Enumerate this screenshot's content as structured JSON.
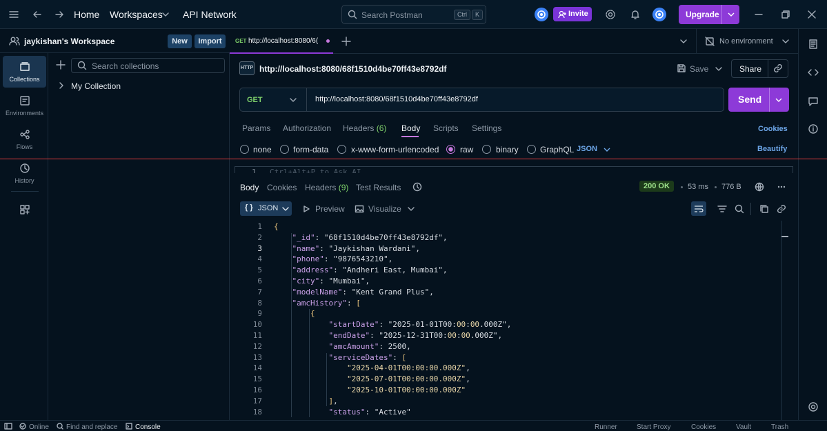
{
  "topbar": {
    "home": "Home",
    "workspaces": "Workspaces",
    "api_network": "API Network",
    "search_placeholder": "Search Postman",
    "kbd_ctrl": "Ctrl",
    "kbd_k": "K",
    "invite": "Invite",
    "upgrade": "Upgrade"
  },
  "workspace": {
    "name": "jaykishan's Workspace",
    "new_label": "New",
    "import_label": "Import"
  },
  "rail": {
    "items": [
      {
        "label": "Collections",
        "icon": "collections-icon"
      },
      {
        "label": "Environments",
        "icon": "environments-icon"
      },
      {
        "label": "Flows",
        "icon": "flows-icon"
      },
      {
        "label": "History",
        "icon": "history-icon"
      }
    ]
  },
  "sidebar": {
    "search_placeholder": "Search collections",
    "collection": "My Collection"
  },
  "tab": {
    "method": "GET",
    "title": "http://localhost:8080/6("
  },
  "environment": "No environment",
  "request": {
    "title": "http://localhost:8080/68f1510d4be70ff43e8792df",
    "save": "Save",
    "share": "Share",
    "method": "GET",
    "url": "http://localhost:8080/68f1510d4be70ff43e8792df",
    "send": "Send"
  },
  "request_tabs": {
    "params": "Params",
    "authorization": "Authorization",
    "headers": "Headers",
    "headers_count": "(6)",
    "body": "Body",
    "scripts": "Scripts",
    "settings": "Settings",
    "cookies": "Cookies"
  },
  "body_modes": {
    "none": "none",
    "form_data": "form-data",
    "urlencoded": "x-www-form-urlencoded",
    "raw": "raw",
    "binary": "binary",
    "graphql": "GraphQL",
    "json": "JSON",
    "beautify": "Beautify"
  },
  "editor_hint": "Ctrl+Alt+P to Ask AI",
  "editor_line": "1",
  "response": {
    "tabs": {
      "body": "Body",
      "cookies": "Cookies",
      "headers": "Headers",
      "headers_count": "(9)",
      "test_results": "Test Results"
    },
    "status": "200 OK",
    "time": "53 ms",
    "size": "776 B",
    "format": "JSON",
    "preview": "Preview",
    "visualize": "Visualize"
  },
  "code_lines": [
    {
      "n": "1",
      "t": "{"
    },
    {
      "n": "2",
      "t": "    \"_id\": \"68f1510d4be70ff43e8792df\","
    },
    {
      "n": "3",
      "t": "    \"name\": \"Jaykishan Wardani\","
    },
    {
      "n": "4",
      "t": "    \"phone\": \"9876543210\","
    },
    {
      "n": "5",
      "t": "    \"address\": \"Andheri East, Mumbai\","
    },
    {
      "n": "6",
      "t": "    \"city\": \"Mumbai\","
    },
    {
      "n": "7",
      "t": "    \"modelName\": \"Kent Grand Plus\","
    },
    {
      "n": "8",
      "t": "    \"amcHistory\": ["
    },
    {
      "n": "9",
      "t": "        {"
    },
    {
      "n": "10",
      "t": "            \"startDate\": \"2025-01-01T00:00:00.000Z\","
    },
    {
      "n": "11",
      "t": "            \"endDate\": \"2025-12-31T00:00:00.000Z\","
    },
    {
      "n": "12",
      "t": "            \"amcAmount\": 2500,"
    },
    {
      "n": "13",
      "t": "            \"serviceDates\": ["
    },
    {
      "n": "14",
      "t": "                \"2025-04-01T00:00:00.000Z\","
    },
    {
      "n": "15",
      "t": "                \"2025-07-01T00:00:00.000Z\","
    },
    {
      "n": "16",
      "t": "                \"2025-10-01T00:00:00.000Z\""
    },
    {
      "n": "17",
      "t": "            ],"
    },
    {
      "n": "18",
      "t": "            \"status\": \"Active\""
    }
  ],
  "statusbar": {
    "online": "Online",
    "find_replace": "Find and replace",
    "console": "Console",
    "runner": "Runner",
    "start_proxy": "Start Proxy",
    "cookies": "Cookies",
    "vault": "Vault",
    "trash": "Trash"
  },
  "colors": {
    "accent": "#8d3ad8",
    "background": "#05121e",
    "status_ok": "#7fd16b"
  }
}
